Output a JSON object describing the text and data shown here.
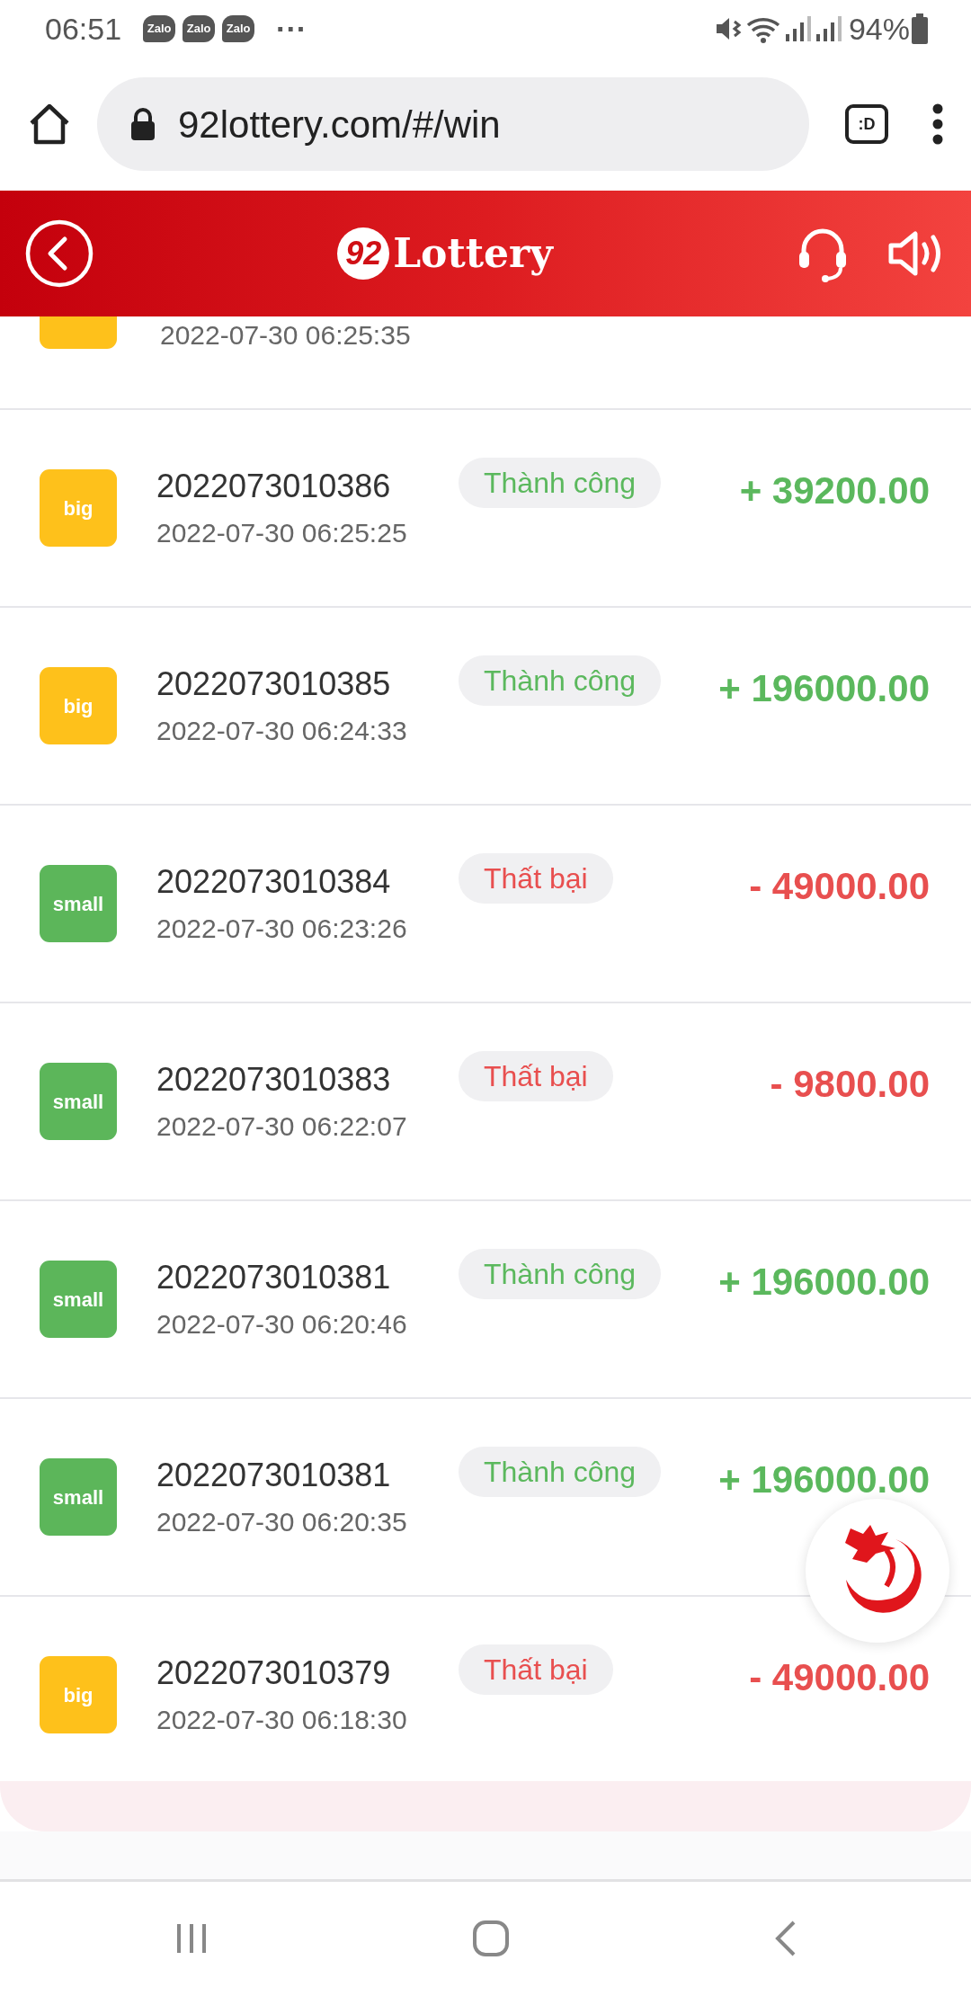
{
  "status_bar": {
    "time": "06:51",
    "notifications": [
      "Zalo",
      "Zalo",
      "Zalo"
    ],
    "more": "···",
    "battery_text": "94%"
  },
  "browser": {
    "url": "92lottery.com/#/win",
    "tab_label": ":D"
  },
  "header": {
    "logo_mark": "92",
    "logo_text": "Lottery"
  },
  "partial_row": {
    "kind": "big",
    "date": "2022-07-30 06:25:35"
  },
  "rows": [
    {
      "kind": "big",
      "label": "big",
      "id": "2022073010386",
      "date": "2022-07-30 06:25:25",
      "status": "Thành công",
      "success": true,
      "amount": "+ 39200.00"
    },
    {
      "kind": "big",
      "label": "big",
      "id": "2022073010385",
      "date": "2022-07-30 06:24:33",
      "status": "Thành công",
      "success": true,
      "amount": "+ 196000.00"
    },
    {
      "kind": "small",
      "label": "small",
      "id": "2022073010384",
      "date": "2022-07-30 06:23:26",
      "status": "Thất bại",
      "success": false,
      "amount": "- 49000.00"
    },
    {
      "kind": "small",
      "label": "small",
      "id": "2022073010383",
      "date": "2022-07-30 06:22:07",
      "status": "Thất bại",
      "success": false,
      "amount": "- 9800.00"
    },
    {
      "kind": "small",
      "label": "small",
      "id": "2022073010381",
      "date": "2022-07-30 06:20:46",
      "status": "Thành công",
      "success": true,
      "amount": "+ 196000.00"
    },
    {
      "kind": "small",
      "label": "small",
      "id": "2022073010381",
      "date": "2022-07-30 06:20:35",
      "status": "Thành công",
      "success": true,
      "amount": "+ 196000.00"
    },
    {
      "kind": "big",
      "label": "big",
      "id": "2022073010379",
      "date": "2022-07-30 06:18:30",
      "status": "Thất bại",
      "success": false,
      "amount": "- 49000.00"
    }
  ]
}
